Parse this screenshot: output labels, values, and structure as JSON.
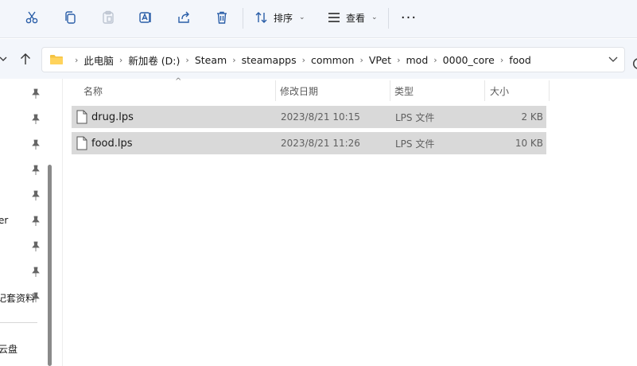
{
  "toolbar": {
    "sort_label": "排序",
    "view_label": "查看"
  },
  "address": {
    "crumbs": [
      "此电脑",
      "新加卷 (D:)",
      "Steam",
      "steamapps",
      "common",
      "VPet",
      "mod",
      "0000_core",
      "food"
    ]
  },
  "sidebar": {
    "labels": [
      "er",
      "记套资料",
      "云盘"
    ]
  },
  "columns": {
    "name": "名称",
    "date": "修改日期",
    "type": "类型",
    "size": "大小"
  },
  "files": [
    {
      "name": "drug.lps",
      "date": "2023/8/21 10:15",
      "type": "LPS 文件",
      "size": "2 KB"
    },
    {
      "name": "food.lps",
      "date": "2023/8/21 11:26",
      "type": "LPS 文件",
      "size": "10 KB"
    }
  ],
  "colors": {
    "accent": "#2a5ea8",
    "row_selected": "#d9d9d9",
    "folder": "#f4c342"
  }
}
